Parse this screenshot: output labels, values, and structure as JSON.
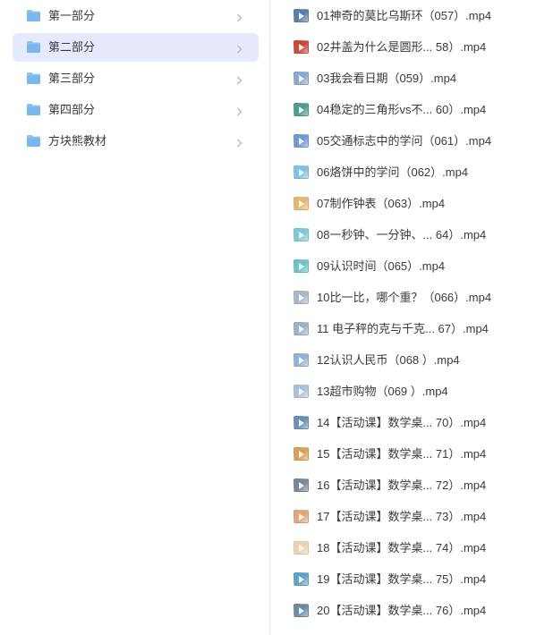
{
  "folders": [
    {
      "label": "第一部分",
      "selected": false
    },
    {
      "label": "第二部分",
      "selected": true
    },
    {
      "label": "第三部分",
      "selected": false
    },
    {
      "label": "第四部分",
      "selected": false
    },
    {
      "label": "方块熊教材",
      "selected": false
    }
  ],
  "files": [
    {
      "name": "01神奇的莫比乌斯环（057）.mp4",
      "thumb_color": "#5a7fa6"
    },
    {
      "name": "02井盖为什么是圆形...  58）.mp4",
      "thumb_color": "#c94a3c"
    },
    {
      "name": "03我会看日期（059）.mp4",
      "thumb_color": "#8aa9c8"
    },
    {
      "name": "04稳定的三角形vs不...  60）.mp4",
      "thumb_color": "#4e9b8f"
    },
    {
      "name": "05交通标志中的学问（061）.mp4",
      "thumb_color": "#6f9bd1"
    },
    {
      "name": "06烙饼中的学问（062）.mp4",
      "thumb_color": "#7ec4e0"
    },
    {
      "name": "07制作钟表（063）.mp4",
      "thumb_color": "#e5b774"
    },
    {
      "name": "08一秒钟、一分钟、...  64）.mp4",
      "thumb_color": "#7fc8d8"
    },
    {
      "name": "09认识时间（065）.mp4",
      "thumb_color": "#6cc4c9"
    },
    {
      "name": "10比一比，哪个重？（066）.mp4",
      "thumb_color": "#a8b7c9"
    },
    {
      "name": "11 电子秤的克与千克...  67）.mp4",
      "thumb_color": "#9fb1c6"
    },
    {
      "name": "12认识人民币（068 ）.mp4",
      "thumb_color": "#8fb3d6"
    },
    {
      "name": "13超市购物（069 ）.mp4",
      "thumb_color": "#a9c2da"
    },
    {
      "name": "14【活动课】数学桌...  70）.mp4",
      "thumb_color": "#6d8fb4"
    },
    {
      "name": "15【活动课】数学桌...  71）.mp4",
      "thumb_color": "#d9a15a"
    },
    {
      "name": "16【活动课】数学桌...  72）.mp4",
      "thumb_color": "#7a8896"
    },
    {
      "name": "17【活动课】数学桌...  73）.mp4",
      "thumb_color": "#e0a77a"
    },
    {
      "name": "18【活动课】数学桌...  74）.mp4",
      "thumb_color": "#ecd2b0"
    },
    {
      "name": "19【活动课】数学桌...  75）.mp4",
      "thumb_color": "#5fa3c7"
    },
    {
      "name": "20【活动课】数学桌...  76）.mp4",
      "thumb_color": "#6f8aa8"
    }
  ],
  "icons": {
    "folder": "folder-icon",
    "chevron": "chevron-right-icon",
    "video": "video-thumbnail-icon"
  },
  "colors": {
    "folder": "#7ab7ec",
    "selected_bg": "#e6eafc",
    "chevron": "#b5b5b5"
  }
}
